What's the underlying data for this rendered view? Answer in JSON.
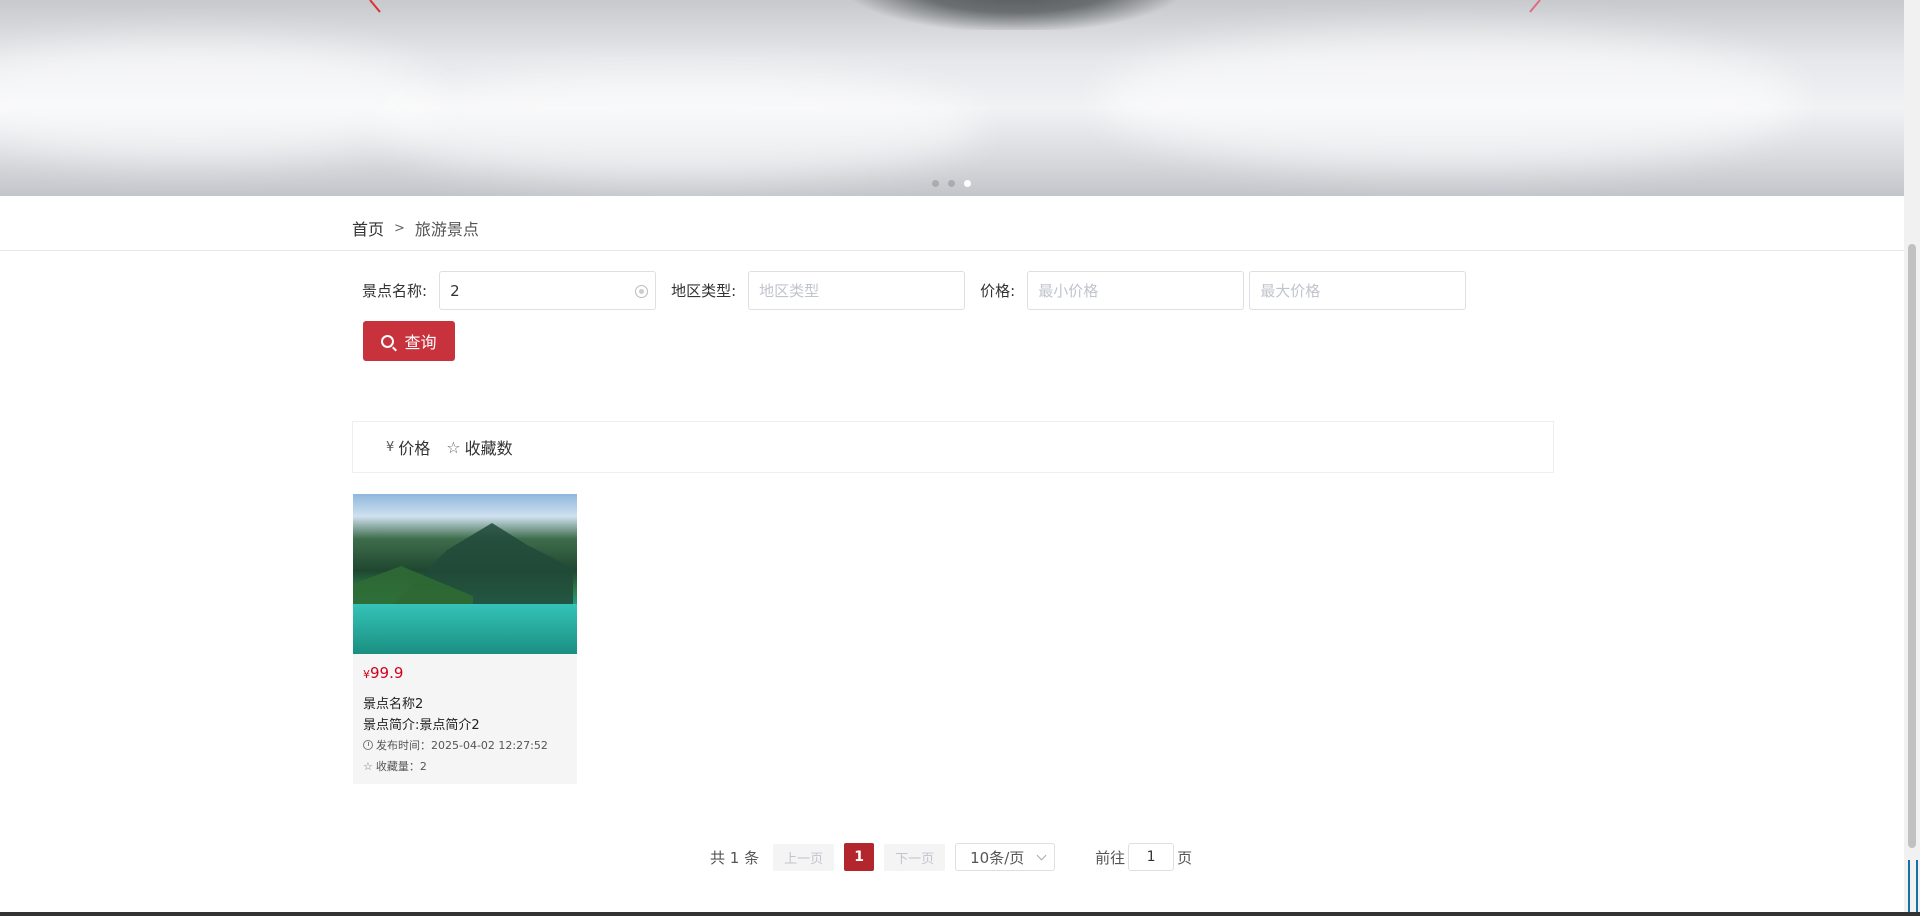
{
  "breadcrumb": {
    "home": "首页",
    "separator": ">",
    "current": "旅游景点"
  },
  "search": {
    "name_label": "景点名称:",
    "name_value": "2",
    "region_label": "地区类型:",
    "region_placeholder": "地区类型",
    "price_label": "价格:",
    "min_price_placeholder": "最小价格",
    "max_price_placeholder": "最大价格",
    "query_label": "查询"
  },
  "sort": {
    "price_symbol": "¥",
    "price_label": "价格",
    "favorites_label": "收藏数"
  },
  "cards": [
    {
      "currency": "¥",
      "price": "99.9",
      "name": "景点名称2",
      "intro": "景点简介:景点简介2",
      "published": "发布时间：2025-04-02 12:27:52",
      "favorites": "收藏量：2"
    }
  ],
  "pagination": {
    "total": "共 1 条",
    "prev": "上一页",
    "current_page": "1",
    "next": "下一页",
    "page_size": "10条/页",
    "goto_label": "前往",
    "goto_value": "1",
    "page_suffix": "页"
  },
  "banner": {
    "active_dot": 3,
    "dot_count": 3
  }
}
